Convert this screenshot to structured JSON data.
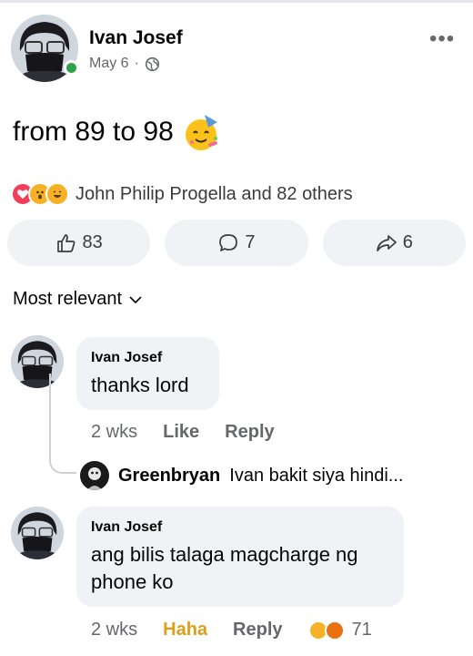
{
  "post": {
    "author": "Ivan Josef",
    "date": "May 6",
    "separator": "·",
    "text": "from 89 to 98",
    "more_label": "•••"
  },
  "reactions_summary": {
    "text": "John Philip Progella and 82 others",
    "icons": [
      "love-icon",
      "wow-icon",
      "haha-icon"
    ]
  },
  "actions": {
    "like_count": "83",
    "comment_count": "7",
    "share_count": "6"
  },
  "sort": {
    "label": "Most relevant"
  },
  "comments": [
    {
      "author": "Ivan Josef",
      "text": "thanks lord",
      "time": "2 wks",
      "like_label": "Like",
      "reply_label": "Reply",
      "reply_preview": {
        "author": "Greenbryan",
        "text": "Ivan bakit siya hindi..."
      }
    },
    {
      "author": "Ivan Josef",
      "text_line1": "ang bilis talaga magcharge ng",
      "text_line2": "phone ko",
      "time": "2 wks",
      "reaction_label": "Haha",
      "reply_label": "Reply",
      "reaction_count": "71"
    }
  ],
  "colors": {
    "online": "#31a24c",
    "haha": "#d8a01c",
    "love": "#f33e58",
    "bubble": "#f0f2f5"
  }
}
